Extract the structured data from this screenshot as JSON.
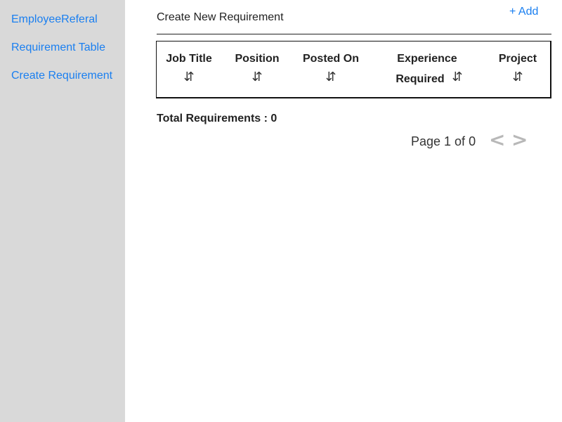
{
  "sidebar": {
    "items": [
      {
        "label": "EmployeeReferal"
      },
      {
        "label": "Requirement Table"
      },
      {
        "label": "Create Requirement"
      }
    ]
  },
  "header": {
    "title": "Create New Requirement",
    "add_label": "+ Add"
  },
  "table": {
    "columns": [
      {
        "label": "Job Title",
        "sort_icon": "⇵"
      },
      {
        "label": "Position",
        "sort_icon": "⇵"
      },
      {
        "label": "Posted On",
        "sort_icon": "⇵"
      },
      {
        "label_line1": "Experience",
        "label_line2": "Required",
        "sort_icon": "⇵"
      },
      {
        "label": "Project",
        "sort_icon": "⇵"
      }
    ],
    "rows": []
  },
  "summary": {
    "total_text": "Total Requirements : 0"
  },
  "pagination": {
    "page_text": "Page 1 of 0",
    "prev_glyph": "<",
    "next_glyph": ">"
  },
  "colors": {
    "sidebar_bg": "#d9d9d9",
    "link": "#1a7ff0",
    "pager_disabled": "#b8b8b8"
  }
}
